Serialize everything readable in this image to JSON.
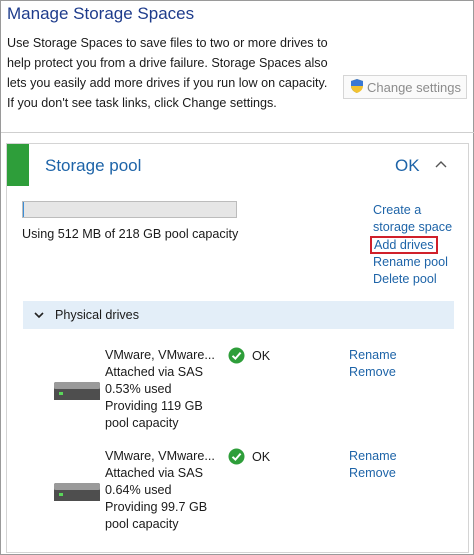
{
  "window": {
    "title": "Manage Storage Spaces",
    "description": "Use Storage Spaces to save files to two or more drives to help protect you from a drive failure. Storage Spaces also lets you easily add more drives if you run low on capacity. If you don't see task links, click Change settings.",
    "change_settings_label": "Change settings"
  },
  "pool": {
    "title": "Storage pool",
    "status": "OK",
    "usage_fraction": 0.0023,
    "usage_text": "Using 512 MB of 218 GB pool capacity",
    "links": {
      "create_storage_space_line1": "Create a",
      "create_storage_space_line2": "storage space",
      "add_drives": "Add drives",
      "rename_pool": "Rename pool",
      "delete_pool": "Delete pool"
    }
  },
  "physical_drives": {
    "header": "Physical drives",
    "drives": [
      {
        "name": "VMware, VMware...",
        "attached": "Attached via SAS",
        "used": "0.53% used",
        "providing": "Providing 119 GB",
        "providing_suffix": "pool capacity",
        "status": "OK",
        "rename": "Rename",
        "remove": "Remove"
      },
      {
        "name": "VMware, VMware...",
        "attached": "Attached via SAS",
        "used": "0.64% used",
        "providing": "Providing 99.7 GB",
        "providing_suffix": "pool capacity",
        "status": "OK",
        "rename": "Rename",
        "remove": "Remove"
      }
    ]
  },
  "colors": {
    "title_blue": "#1e3c8c",
    "link_blue": "#1e64a8",
    "status_green": "#2e9e3a",
    "highlight_red": "#d0202a"
  }
}
